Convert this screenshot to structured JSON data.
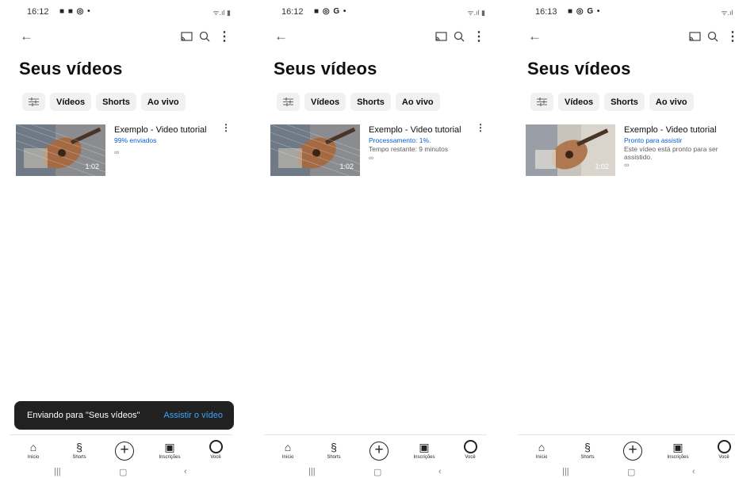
{
  "screens": [
    {
      "status_time": "16:12",
      "status_icons": "■ ■ ◎ •",
      "status_right": "ᯤ.ıl ▮",
      "title": "Seus vídeos",
      "chips": [
        "Vídeos",
        "Shorts",
        "Ao vivo"
      ],
      "video": {
        "title": "Exemplo - Video tutorial",
        "status": "99% enviados",
        "sub": "",
        "duration": "1:02"
      },
      "snackbar": {
        "text": "Enviando para \"Seus vídeos\"",
        "action": "Assistir o vídeo"
      }
    },
    {
      "status_time": "16:12",
      "status_icons": "■ ◎ G •",
      "status_right": "ᯤ.ıl ▮",
      "title": "Seus vídeos",
      "chips": [
        "Vídeos",
        "Shorts",
        "Ao vivo"
      ],
      "video": {
        "title": "Exemplo - Video tutorial",
        "status": "Processamento: 1%.",
        "sub": "Tempo restante: 9 minutos",
        "duration": "1:02"
      }
    },
    {
      "status_time": "16:13",
      "status_icons": "■ ◎ G •",
      "status_right": "ᯤ.ıl ▮",
      "title": "Seus vídeos",
      "chips": [
        "Vídeos",
        "Shorts",
        "Ao vivo"
      ],
      "video": {
        "title": "Exemplo - Video tutorial",
        "status": "Pronto para assistir",
        "sub": "Este vídeo está pronto para ser assistido.",
        "duration": "1:02"
      }
    }
  ],
  "nav": {
    "home": "Início",
    "shorts": "Shorts",
    "subscriptions": "Inscrições",
    "you": "Você"
  },
  "icons": {
    "back": "arrow-left-icon",
    "cast": "cast-icon",
    "search": "search-icon",
    "more": "more-vert-icon",
    "link": "link-icon"
  },
  "colors": {
    "accent": "#065fd4",
    "snackbar_bg": "#212121",
    "snackbar_action": "#3ea6ff",
    "chip_bg": "#f1f1f1"
  }
}
